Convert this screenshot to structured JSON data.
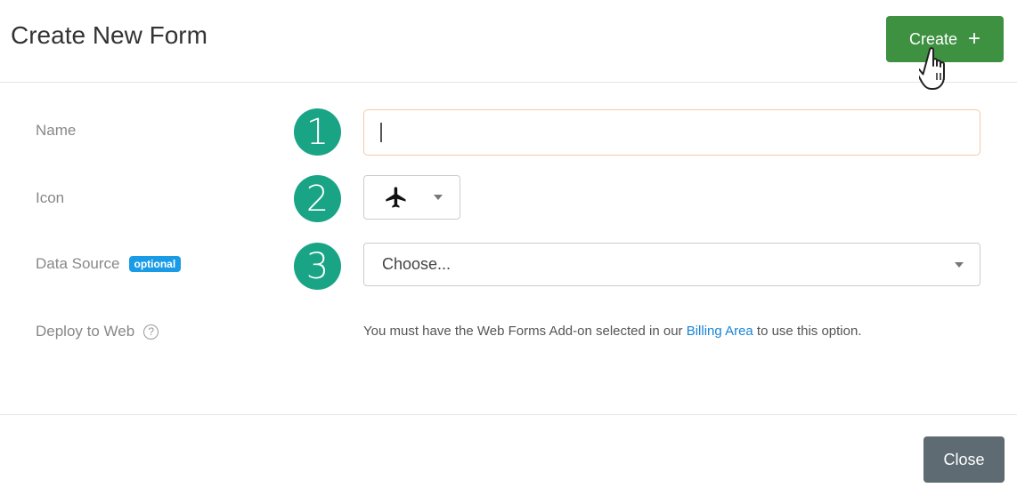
{
  "header": {
    "title": "Create New Form",
    "create_label": "Create",
    "create_icon": "plus-icon",
    "cursor_icon": "hand-pointer-icon"
  },
  "form": {
    "name": {
      "label": "Name",
      "step": "1",
      "value": ""
    },
    "icon": {
      "label": "Icon",
      "step": "2",
      "selected_icon": "airplane-icon"
    },
    "data_source": {
      "label": "Data Source",
      "badge": "optional",
      "step": "3",
      "selected": "Choose..."
    },
    "deploy": {
      "label": "Deploy to Web",
      "help_icon": "question-circle-icon",
      "note_prefix": "You must have the Web Forms Add-on selected in our ",
      "note_link": "Billing Area",
      "note_suffix": " to use this option."
    }
  },
  "footer": {
    "close_label": "Close"
  },
  "colors": {
    "create_button": "#3f9142",
    "step_circle": "#1aa486",
    "badge": "#1a9be6",
    "link": "#1a84d6",
    "close_button": "#5e6b73",
    "name_input_border": "#f5c9a6"
  }
}
